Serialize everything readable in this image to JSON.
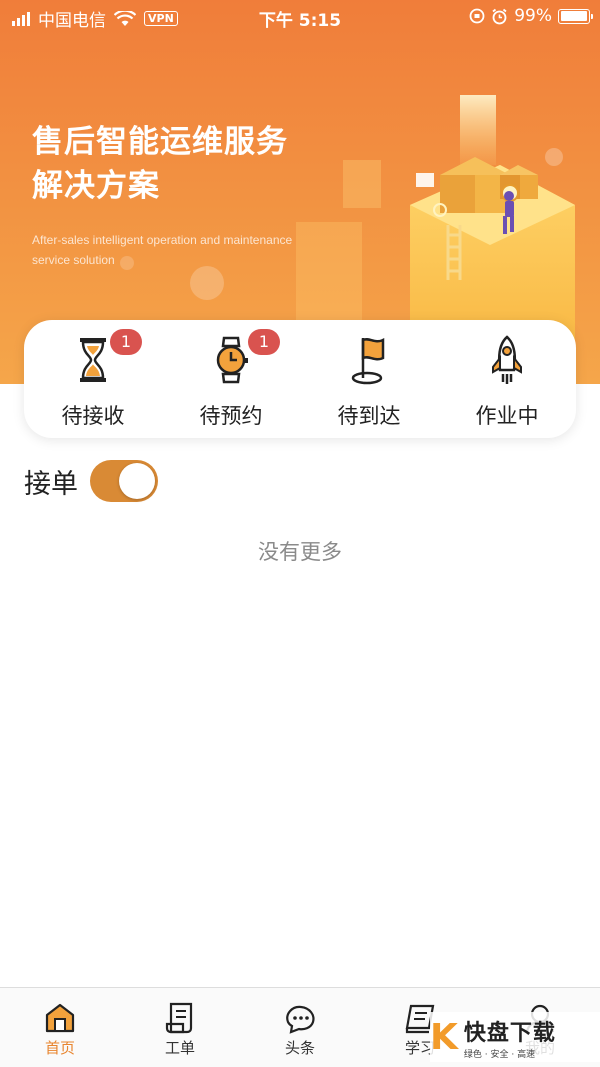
{
  "status_bar": {
    "carrier": "中国电信",
    "vpn": "VPN",
    "time": "下午 5:15",
    "battery": "99%",
    "battery_level": 0.99
  },
  "hero": {
    "title_line1": "售后智能运维服务",
    "title_line2": "解决方案",
    "subtitle": "After-sales intelligent operation and maintenance service solution"
  },
  "actions": [
    {
      "label": "待接收",
      "badge": "1",
      "icon": "hourglass-icon"
    },
    {
      "label": "待预约",
      "badge": "1",
      "icon": "watch-icon"
    },
    {
      "label": "待到达",
      "badge": "",
      "icon": "flag-icon"
    },
    {
      "label": "作业中",
      "badge": "",
      "icon": "rocket-icon"
    }
  ],
  "accept_orders": {
    "label": "接单",
    "enabled": true
  },
  "list_empty_text": "没有更多",
  "tabs": [
    {
      "label": "首页",
      "icon": "home-icon",
      "active": true
    },
    {
      "label": "工单",
      "icon": "document-icon",
      "active": false
    },
    {
      "label": "头条",
      "icon": "chat-bubble-icon",
      "active": false
    },
    {
      "label": "学习",
      "icon": "book-icon",
      "active": false
    },
    {
      "label": "我的",
      "icon": "profile-icon",
      "active": false
    }
  ],
  "watermark": {
    "glyph": "K",
    "title": "快盘下载",
    "sub": "绿色 · 安全 · 高速"
  },
  "colors": {
    "brand_orange": "#f07d3a",
    "toggle": "#d98a35",
    "badge": "#d9534f",
    "active_tab": "#e8852f"
  }
}
